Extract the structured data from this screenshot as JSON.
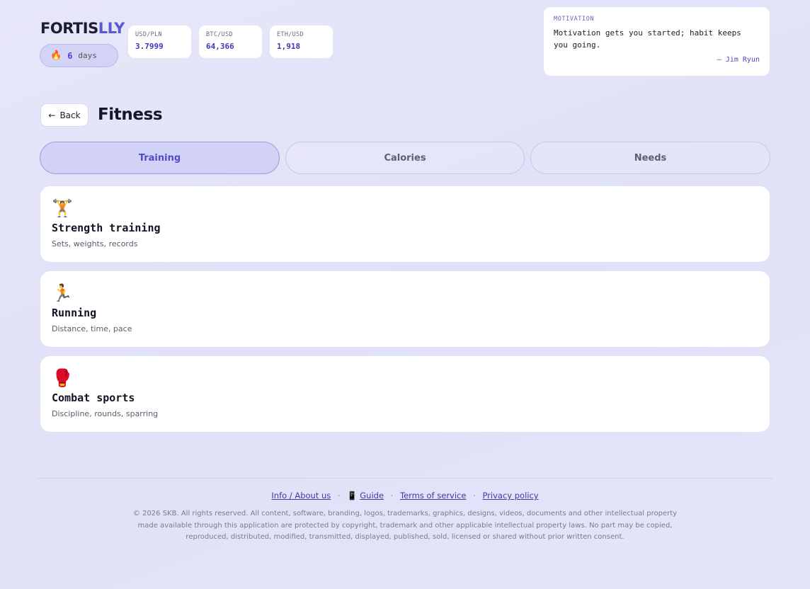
{
  "brand": {
    "part1": "FORTIS",
    "part2": "LLY",
    "accent_color": "#5b57d6"
  },
  "streak": {
    "icon": "fire-icon",
    "glyph": "🔥",
    "count": "6",
    "unit": "days"
  },
  "rates": [
    {
      "pair": "USD/PLN",
      "value": "3.7999"
    },
    {
      "pair": "BTC/USD",
      "value": "64,366"
    },
    {
      "pair": "ETH/USD",
      "value": "1,918"
    }
  ],
  "motivation": {
    "label": "MOTIVATION",
    "text": "Motivation gets you started; habit keeps you going.",
    "author": "— Jim Ryun"
  },
  "header": {
    "back_arrow": "←",
    "back_label": "Back",
    "title": "Fitness"
  },
  "tabs": [
    {
      "label": "Training",
      "active": true
    },
    {
      "label": "Calories",
      "active": false
    },
    {
      "label": "Needs",
      "active": false
    }
  ],
  "cards": [
    {
      "icon": "weightlifter-icon",
      "glyph": "🏋️",
      "title": "Strength training",
      "subtitle": "Sets, weights, records"
    },
    {
      "icon": "runner-icon",
      "glyph": "🏃",
      "title": "Running",
      "subtitle": "Distance, time, pace"
    },
    {
      "icon": "boxing-glove-icon",
      "glyph": "🥊",
      "title": "Combat sports",
      "subtitle": "Discipline, rounds, sparring"
    }
  ],
  "footer": {
    "links": {
      "about": "Info / About us",
      "guide_icon": "📱",
      "guide": "Guide",
      "terms": "Terms of service",
      "privacy": "Privacy policy",
      "separator": "·"
    },
    "legal": "© 2026 SKB. All rights reserved. All content, software, branding, logos, trademarks, graphics, designs, videos, documents and other intellectual property made available through this application are protected by copyright, trademark and other applicable intellectual property laws. No part may be copied, reproduced, distributed, modified, transmitted, displayed, published, sold, licensed or shared without prior written consent."
  }
}
